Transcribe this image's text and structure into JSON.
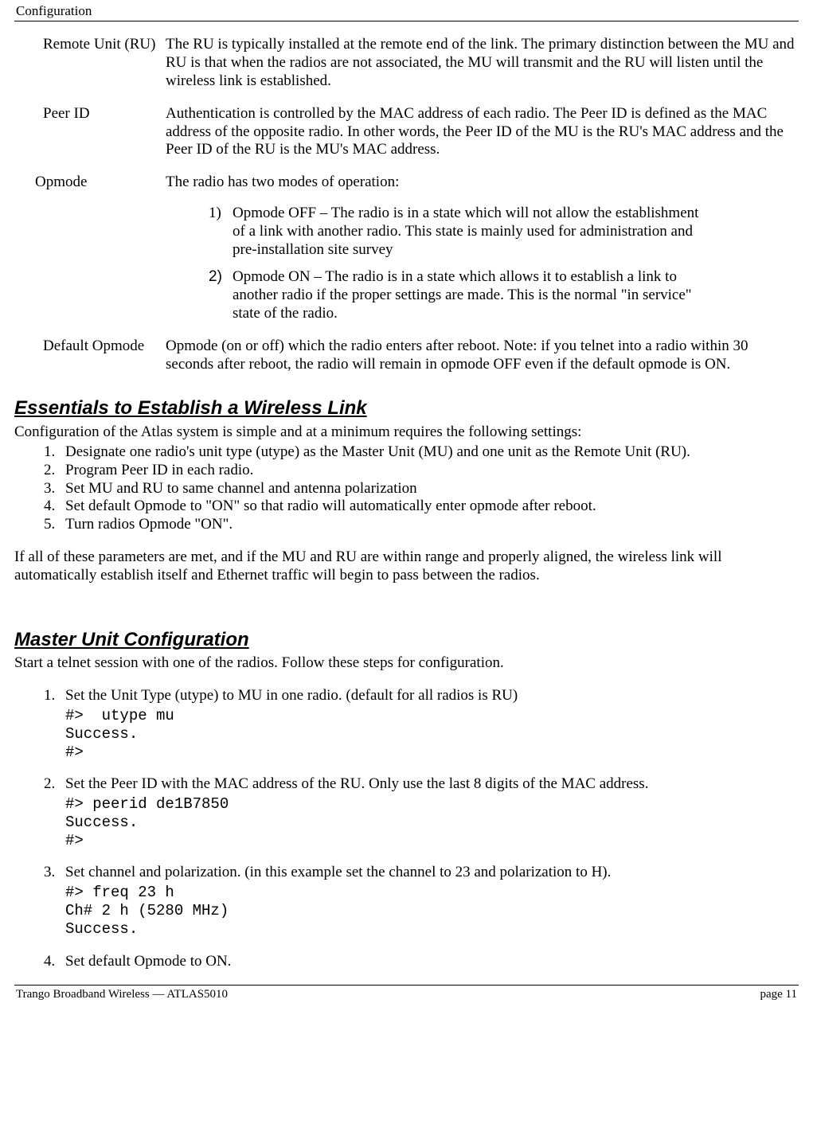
{
  "header": "Configuration",
  "footer_left": "Trango Broadband Wireless — ATLAS5010",
  "footer_right": "page 11",
  "defs": {
    "ru_label": "Remote Unit (RU)",
    "ru_text": "The RU is typically installed at the remote end of the link.   The primary distinction between the MU and RU is that when the radios are not associated, the MU will transmit and the RU will listen until the wireless link is established.",
    "peer_label": "Peer ID",
    "peer_text": "Authentication is controlled by the MAC address of each radio.  The Peer ID is defined as the MAC address of the opposite radio.  In other words, the Peer ID of the MU is the RU's MAC address and the Peer ID of the RU is the MU's MAC address.",
    "opmode_label": "Opmode",
    "opmode_intro": "The radio has two modes of operation:",
    "opmode_1_n": "1)",
    "opmode_1_txt": "Opmode OFF – The radio is in a state which will not allow the establishment of a link with another radio.  This state is mainly used for administration and pre-installation site survey",
    "opmode_2_n": "2)",
    "opmode_2_txt": "Opmode ON – The radio is in a state which allows it to establish a link to another radio if the proper settings are made.  This is the normal \"in service\" state of the radio.",
    "default_label": "Default Opmode",
    "default_text": "Opmode (on or off) which the radio enters after reboot.  Note:  if you telnet into a radio within 30 seconds after reboot, the radio will remain in opmode OFF even if the default opmode is ON."
  },
  "h_essentials": "Essentials to Establish a Wireless Link",
  "essentials_intro": "Configuration of the Atlas system is simple and at a minimum requires the following settings:",
  "ess_list": {
    "i1": "Designate one radio's unit type (utype) as the Master Unit (MU) and one unit as the Remote Unit (RU).",
    "i2": "Program Peer ID  in each radio.",
    "i3": "Set MU and RU to same channel and antenna polarization",
    "i4": "Set default Opmode to \"ON\" so that radio will automatically enter opmode after reboot.",
    "i5": "Turn radios Opmode \"ON\"."
  },
  "ess_outro": "If all of these parameters are met, and if the MU and RU are within range and properly aligned, the wireless link will automatically establish itself and Ethernet traffic will begin to pass between the radios.",
  "h_master": "Master Unit Configuration",
  "master_intro": "Start a telnet session with one of the radios.   Follow these steps for configuration.",
  "master": {
    "s1_text": "Set the Unit Type (utype)  to MU in one radio.   (default for all radios is RU)",
    "s1_code": "#>  utype mu\nSuccess.\n#>",
    "s2_text": "Set the Peer ID with the MAC address of the RU.   Only use the last 8 digits of the MAC address.",
    "s2_code": "#> peerid de1B7850\nSuccess.\n#>",
    "s3_text": "Set channel and polarization. (in this example set the channel to 23 and polarization to H).",
    "s3_code": "#> freq 23 h\nCh# 2 h (5280 MHz)\nSuccess.",
    "s4_text": "Set default Opmode to ON."
  }
}
